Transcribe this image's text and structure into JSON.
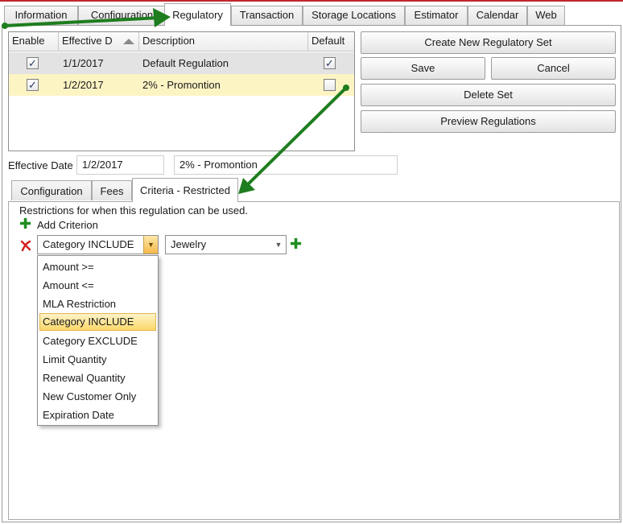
{
  "main_tabs": [
    "Information",
    "Configuration",
    "Regulatory",
    "Transaction",
    "Storage Locations",
    "Estimator",
    "Calendar",
    "Web"
  ],
  "grid": {
    "headers": {
      "enable": "Enable",
      "effective_date": "Effective D",
      "description": "Description",
      "default": "Default"
    },
    "rows": [
      {
        "enable": "✓",
        "effective_date": "1/1/2017",
        "description": "Default Regulation",
        "default": "✓"
      },
      {
        "enable": "✓",
        "effective_date": "1/2/2017",
        "description": "2% - Promontion",
        "default": ""
      }
    ]
  },
  "buttons": {
    "create": "Create New Regulatory Set",
    "save": "Save",
    "cancel": "Cancel",
    "delete": "Delete Set",
    "preview": "Preview Regulations"
  },
  "effective": {
    "label": "Effective Date",
    "date": "1/2/2017",
    "description": "2% - Promontion"
  },
  "sub_tabs": [
    "Configuration",
    "Fees",
    "Criteria - Restricted"
  ],
  "criteria": {
    "restriction_text": "Restrictions for when this regulation can be used.",
    "add_criterion": "Add Criterion",
    "type_value": "Category INCLUDE",
    "category_value": "Jewelry"
  },
  "dropdown_options": [
    "Amount >=",
    "Amount <=",
    "MLA Restriction",
    "Category INCLUDE",
    "Category EXCLUDE",
    "Limit Quantity",
    "Renewal Quantity",
    "New Customer Only",
    "Expiration Date"
  ],
  "colors": {
    "accent_red": "#c0282c",
    "annotation_arrow": "#1e7d1e",
    "selected_row": "#fdf4c4",
    "plus_green": "#1e8f1e",
    "remove_red": "#d21f1f"
  }
}
